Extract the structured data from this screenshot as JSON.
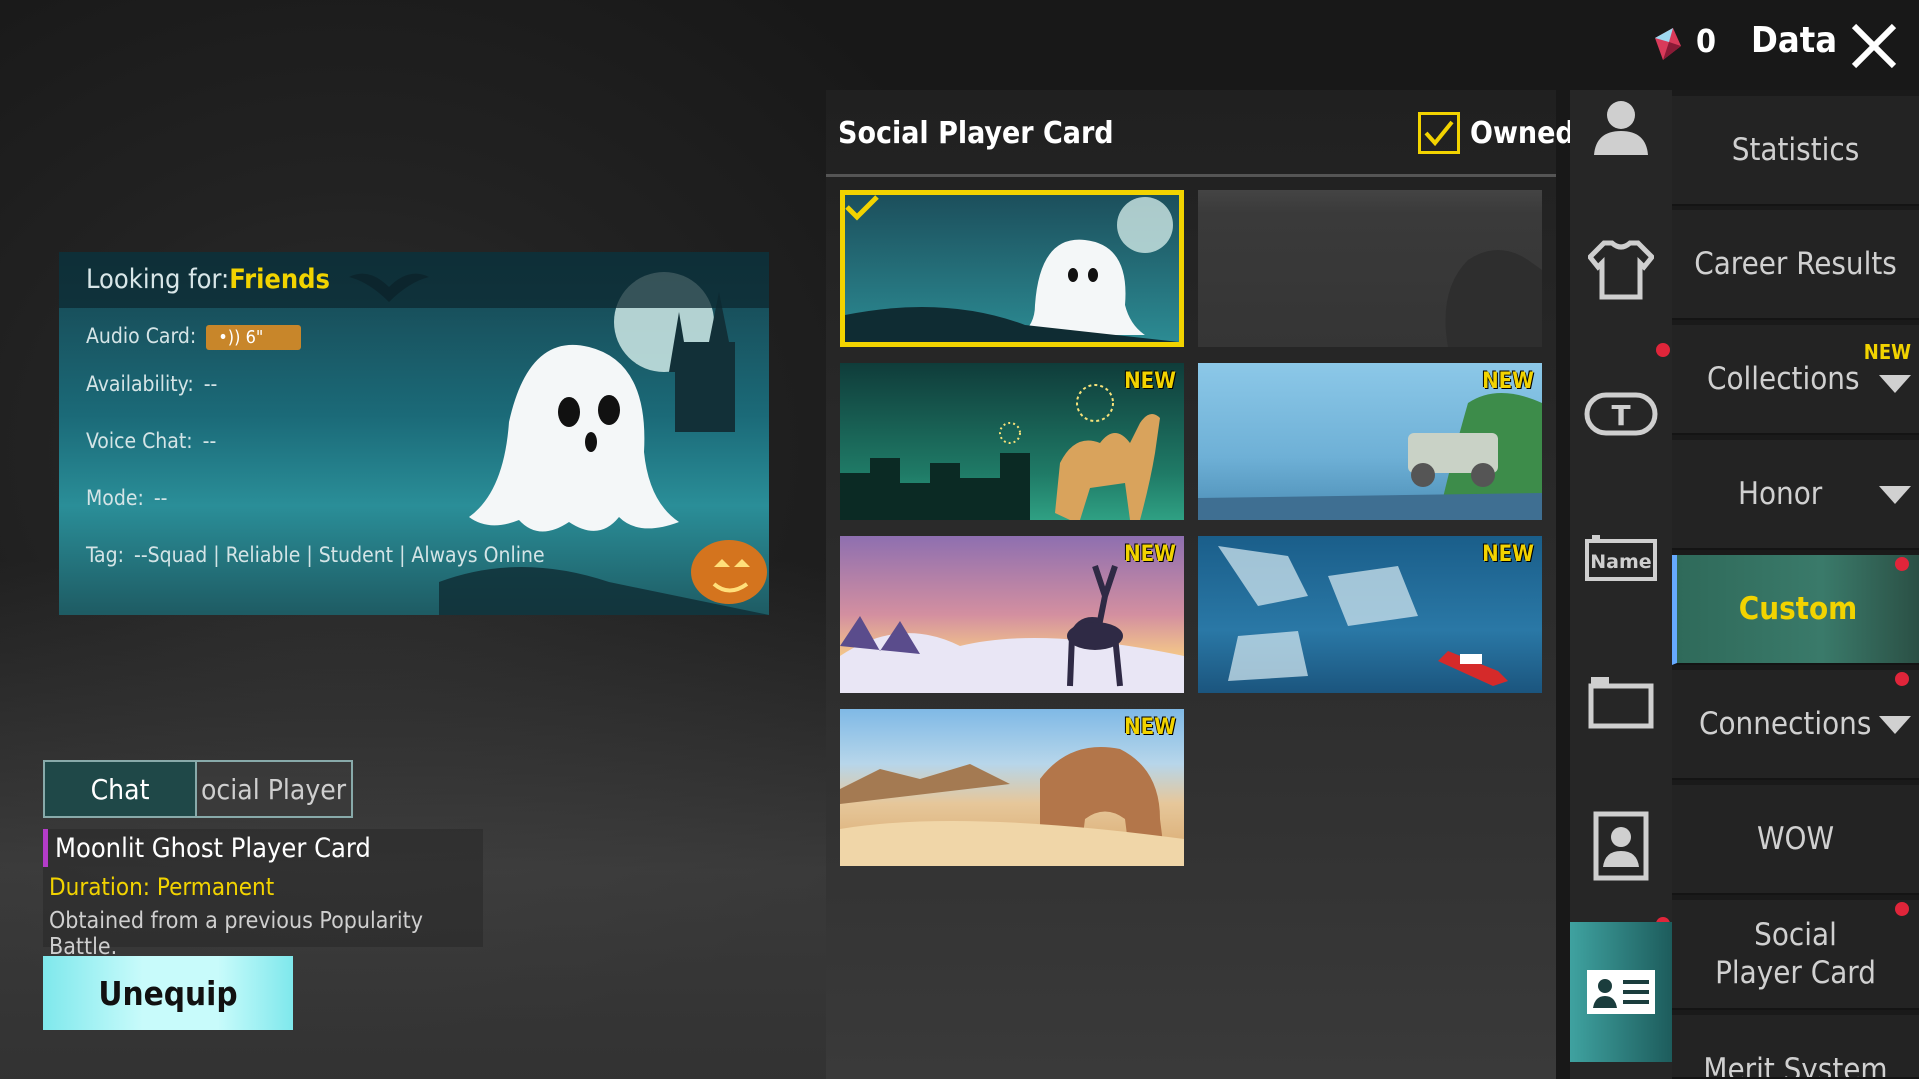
{
  "topbar": {
    "currency_count": "0",
    "title": "Data"
  },
  "preview_card": {
    "looking_for_label": "Looking for:",
    "looking_for_value": "Friends",
    "audio_label": "Audio Card:",
    "audio_value": "6\"",
    "availability_label": "Availability:",
    "availability_value": "--",
    "voice_label": "Voice Chat:",
    "voice_value": "--",
    "mode_label": "Mode:",
    "mode_value": "--",
    "tag_label": "Tag:",
    "tag_value": "--Squad | Reliable | Student | Always Online"
  },
  "tabs": [
    {
      "label": "Chat",
      "active": true
    },
    {
      "label": "ocial Player",
      "active": false
    }
  ],
  "item": {
    "name": "Moonlit Ghost Player Card",
    "duration": "Duration: Permanent",
    "description": "Obtained from a previous Popularity Battle."
  },
  "actions": {
    "unequip_label": "Unequip"
  },
  "panel": {
    "title": "Social Player Card",
    "owned_label": "Owned",
    "owned_checked": true,
    "new_badge": "NEW",
    "cards": [
      {
        "theme": "moonlit-ghost",
        "selected": true,
        "new": false
      },
      {
        "theme": "locked-silhouette",
        "selected": false,
        "new": false
      },
      {
        "theme": "camel-fireworks",
        "selected": false,
        "new": true
      },
      {
        "theme": "vehicle-cliff",
        "selected": false,
        "new": true
      },
      {
        "theme": "deer-sunset",
        "selected": false,
        "new": true
      },
      {
        "theme": "ice-boat",
        "selected": false,
        "new": true
      },
      {
        "theme": "desert-rock",
        "selected": false,
        "new": true
      }
    ]
  },
  "nav": {
    "items": [
      {
        "label": "Statistics"
      },
      {
        "label": "Career Results"
      },
      {
        "label": "Collections",
        "badge": "NEW",
        "dropdown": true
      },
      {
        "label": "Honor",
        "dropdown": true
      },
      {
        "label": "Custom",
        "active": true
      },
      {
        "label": "Connections",
        "dropdown": true
      },
      {
        "label": "WOW"
      },
      {
        "label": "Social Player Card"
      },
      {
        "label": "Merit System"
      }
    ]
  },
  "icons": [
    "profile-icon",
    "outfit-icon",
    "title-icon",
    "name-tag-icon",
    "frame-icon",
    "avatar-frame-icon",
    "player-card-icon"
  ],
  "colors": {
    "accent_yellow": "#f2d300",
    "active_teal": "#3fa2a0",
    "unequip_cyan": "#c8fbfb",
    "notify_red": "#e0253a",
    "item_purple": "#b43cc9"
  }
}
